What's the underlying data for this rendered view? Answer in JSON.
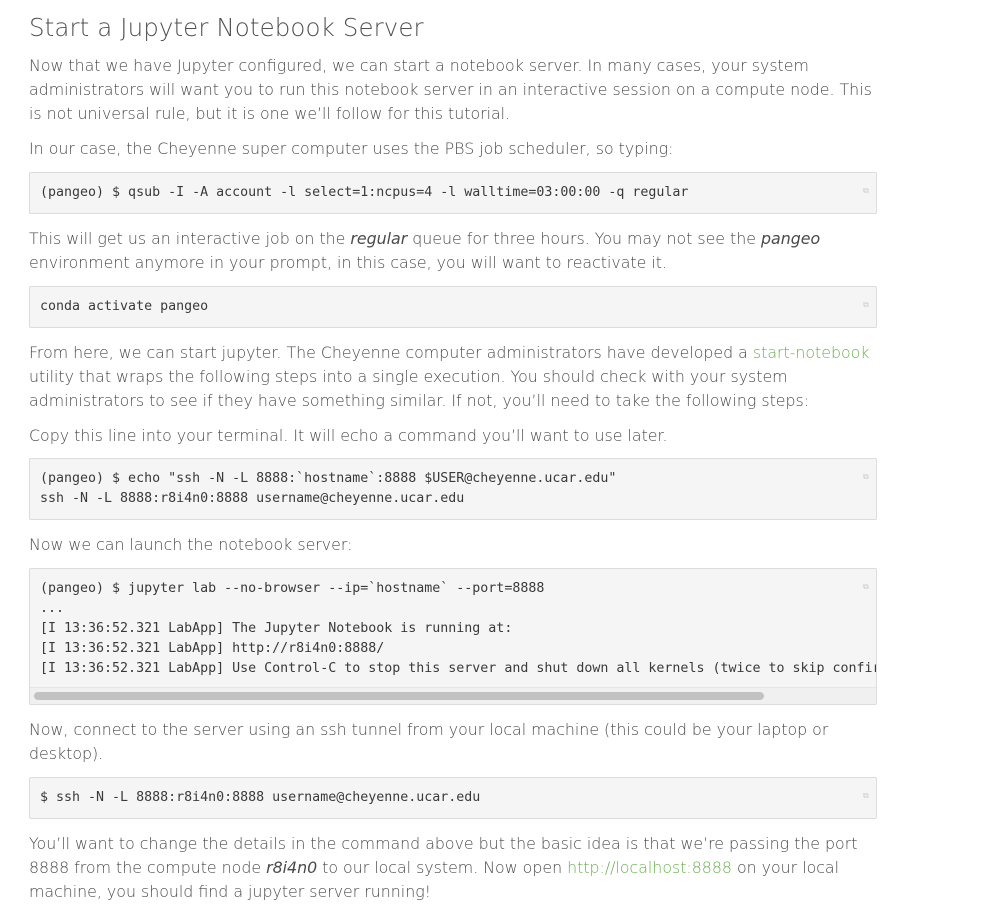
{
  "heading": "Start a Jupyter Notebook Server",
  "intro": "Now that we have Jupyter configured, we can start a notebook server. In many cases, your system administrators will want you to run this notebook server in an interactive session on a compute node. This is not universal rule, but it is one we’ll follow for this tutorial.",
  "cheyenne_intro": "In our case, the Cheyenne super computer uses the PBS job scheduler, so typing:",
  "code_qsub": "(pangeo) $ qsub -I -A account -l select=1:ncpus=4 -l walltime=03:00:00 -q regular",
  "interactive_job": {
    "t1": "This will get us an interactive job on the ",
    "em1": "regular",
    "t2": " queue for three hours. You may not see the ",
    "em2": "pangeo",
    "t3": " environment anymore in your prompt, in this case, you will want to reactivate it."
  },
  "code_activate": "conda activate pangeo",
  "start_jupyter": {
    "t1": "From here, we can start jupyter. The Cheyenne computer administrators have developed a ",
    "link": "start-notebook",
    "t2": " utility that wraps the following steps into a single execution. You should check with your system administrators to see if they have something similar. If not, you’ll need to take the following steps:"
  },
  "copy_line": "Copy this line into your terminal. It will echo a command you’ll want to use later.",
  "code_echo": "(pangeo) $ echo \"ssh -N -L 8888:`hostname`:8888 $USER@cheyenne.ucar.edu\"\nssh -N -L 8888:r8i4n0:8888 username@cheyenne.ucar.edu",
  "launch_text": "Now we can launch the notebook server:",
  "code_launch": "(pangeo) $ jupyter lab --no-browser --ip=`hostname` --port=8888\n...\n[I 13:36:52.321 LabApp] The Jupyter Notebook is running at:\n[I 13:36:52.321 LabApp] http://r8i4n0:8888/\n[I 13:36:52.321 LabApp] Use Control-C to stop this server and shut down all kernels (twice to skip confirmation).",
  "connect_text": "Now, connect to the server using an ssh tunnel from your local machine (this could be your laptop or desktop).",
  "code_ssh": "$ ssh -N -L 8888:r8i4n0:8888 username@cheyenne.ucar.edu",
  "final": {
    "t1": "You’ll want to change the details in the command above but the basic idea is that we’re passing the port 8888 from the compute node ",
    "em": "r8i4n0",
    "t2": " to our local system. Now open ",
    "link": "http://localhost:8888",
    "t3": " on your local machine, you should find a jupyter server running!"
  },
  "copy_icon": "copy-icon",
  "colors": {
    "link": "#6ab04c",
    "code_bg": "#f5f5f5"
  }
}
